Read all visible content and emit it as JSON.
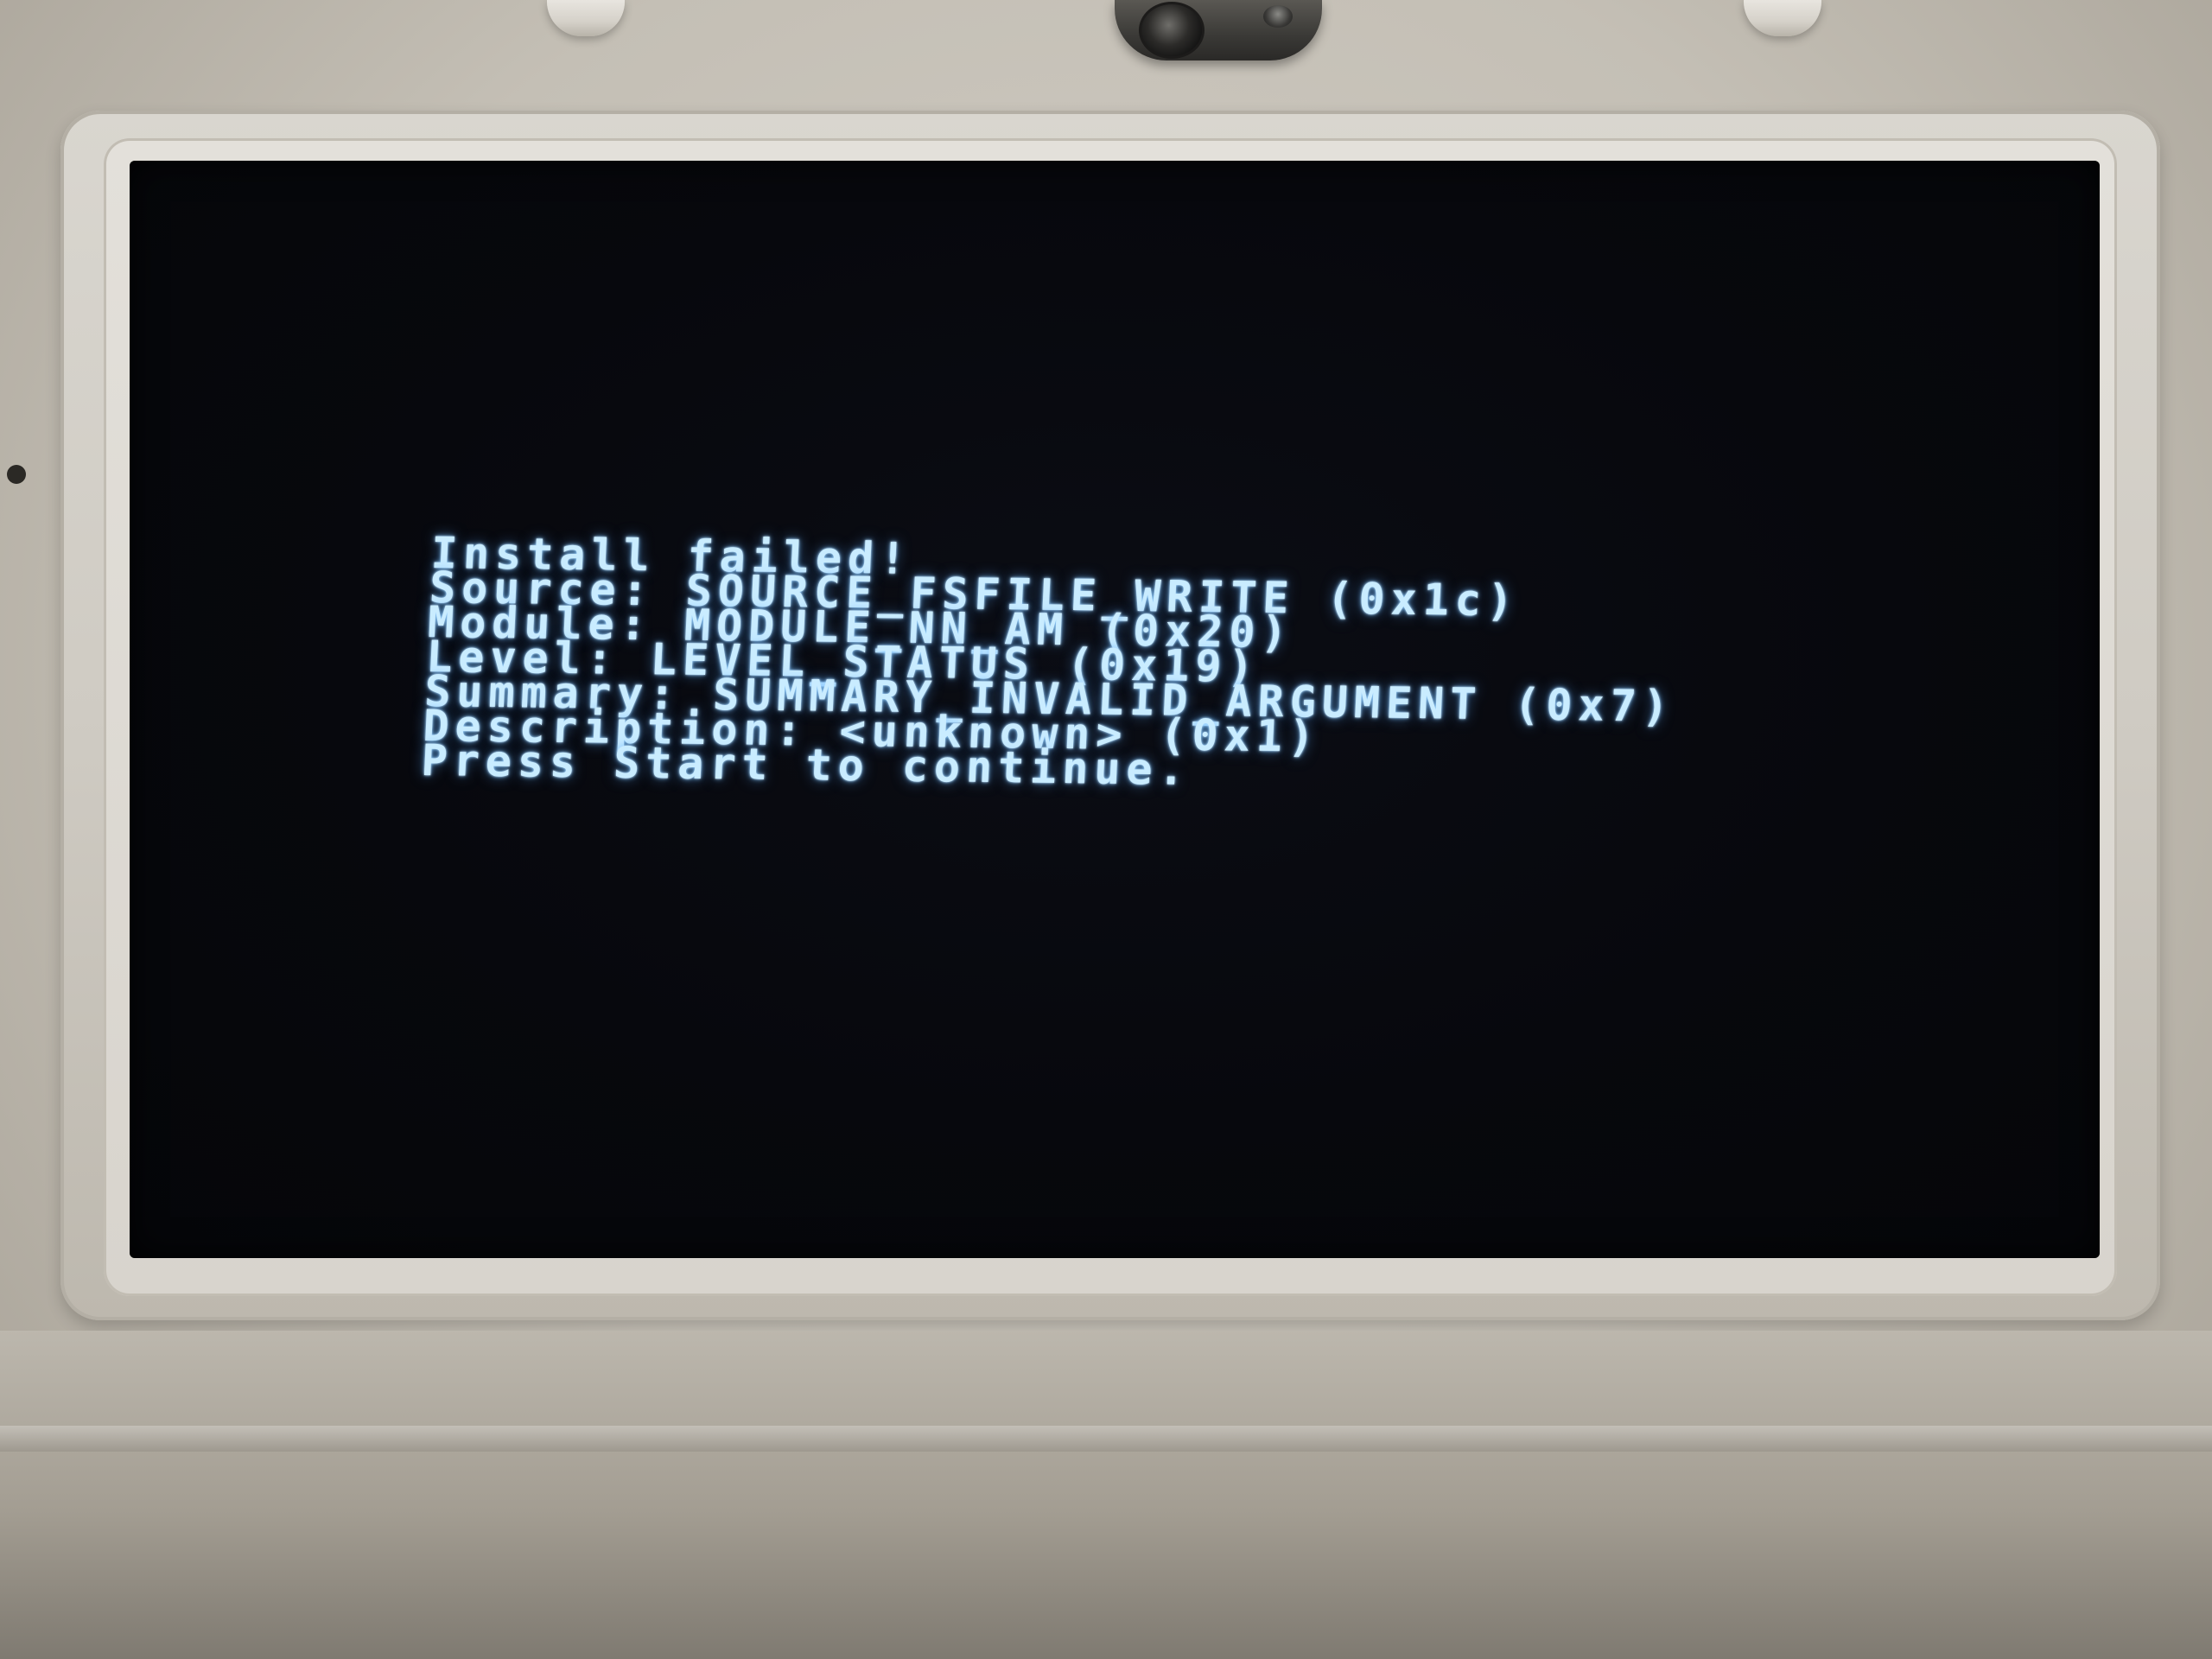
{
  "screen": {
    "text_color": "#c9ecff",
    "background_color": "#07080d",
    "lines": [
      "Install failed!",
      "Source: SOURCE_FSFILE_WRITE (0x1c)",
      "Module: MODULE_NN_AM (0x20)",
      "Level: LEVEL_STATUS (0x19)",
      "Summary: SUMMARY_INVALID_ARGUMENT (0x7)",
      "Description: <unknown> (0x1)",
      "Press Start to continue."
    ]
  },
  "device": {
    "shell_color": "#c9c5bd",
    "camera_icon": "camera-lens-icon"
  }
}
